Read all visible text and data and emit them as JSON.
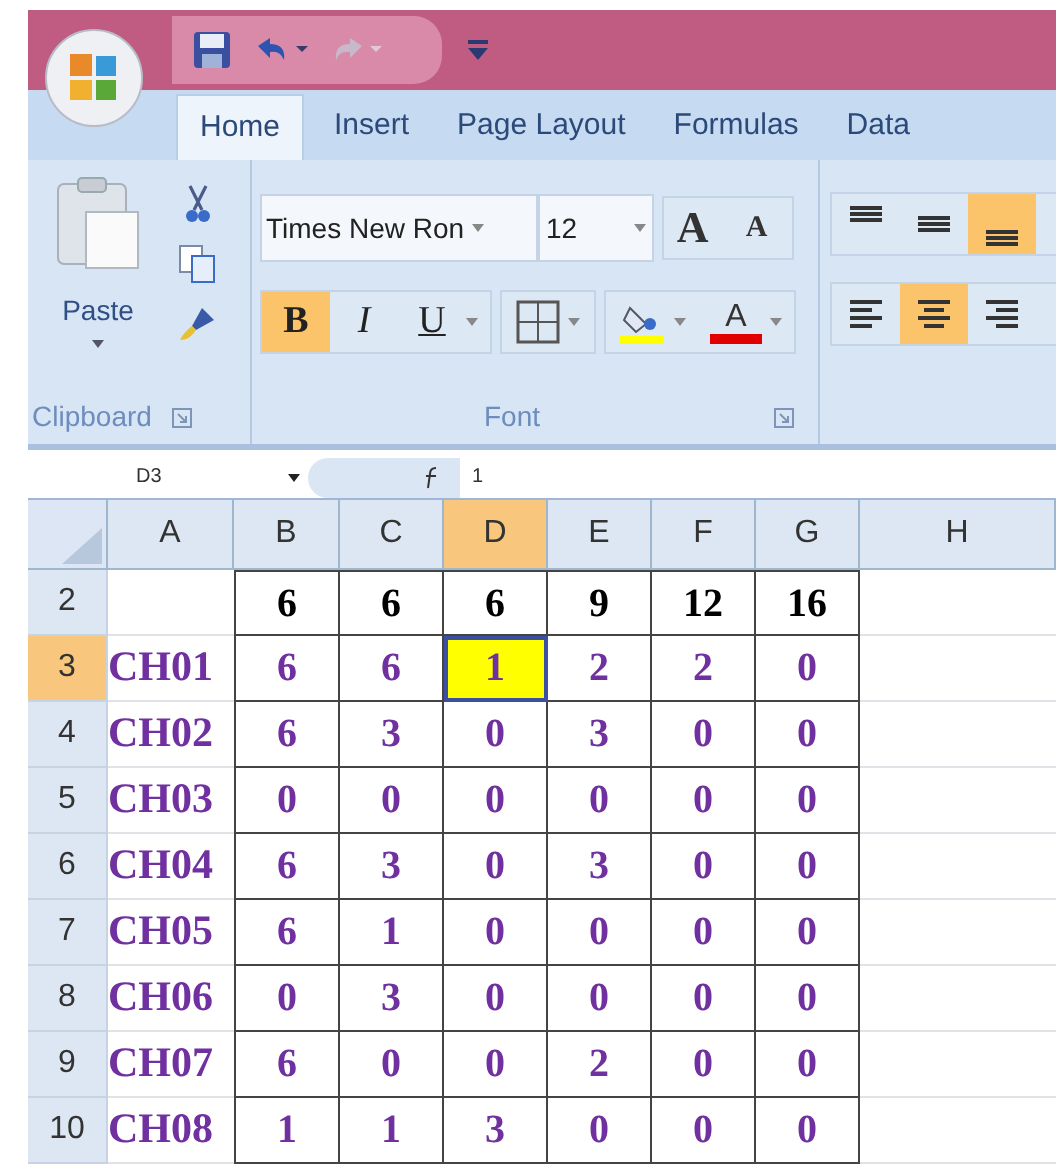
{
  "tabs": [
    {
      "label": "Home",
      "selected": true
    },
    {
      "label": "Insert",
      "selected": false
    },
    {
      "label": "Page Layout",
      "selected": false
    },
    {
      "label": "Formulas",
      "selected": false
    },
    {
      "label": "Data",
      "selected": false
    }
  ],
  "clipboard": {
    "paste_label": "Paste",
    "group_label": "Clipboard"
  },
  "font": {
    "name": "Times New Ron",
    "size": "12",
    "grow_label": "A",
    "shrink_label": "A",
    "font_color_label": "A",
    "group_label": "Font",
    "styles": [
      {
        "kind": "bold",
        "label": "B",
        "selected": true
      },
      {
        "kind": "italic",
        "label": "I",
        "selected": false
      },
      {
        "kind": "underline",
        "label": "U",
        "selected": false
      }
    ]
  },
  "alignment": {
    "vertical": [
      {
        "kind": "top",
        "selected": false
      },
      {
        "kind": "middle",
        "selected": false
      },
      {
        "kind": "bottom",
        "selected": true
      }
    ],
    "horizontal": [
      {
        "kind": "left",
        "selected": false
      },
      {
        "kind": "center",
        "selected": true
      },
      {
        "kind": "right",
        "selected": false
      }
    ]
  },
  "formula_bar": {
    "name_box": "D3",
    "content": "1"
  },
  "columns": [
    {
      "label": "A",
      "selected": false
    },
    {
      "label": "B",
      "selected": false
    },
    {
      "label": "C",
      "selected": false
    },
    {
      "label": "D",
      "selected": true
    },
    {
      "label": "E",
      "selected": false
    },
    {
      "label": "F",
      "selected": false
    },
    {
      "label": "G",
      "selected": false
    },
    {
      "label": "H",
      "selected": false
    }
  ],
  "rows": [
    {
      "label": "2",
      "selected": false,
      "kind": "totals",
      "cells": [
        {
          "selected": false
        },
        {
          "text": "6",
          "selected": false
        },
        {
          "text": "6",
          "selected": false
        },
        {
          "text": "6",
          "selected": false
        },
        {
          "text": "9",
          "selected": false
        },
        {
          "text": "12",
          "selected": false
        },
        {
          "text": "16",
          "selected": false
        }
      ]
    },
    {
      "label": "3",
      "selected": true,
      "kind": "channel",
      "cells": [
        {
          "text": "CH01",
          "selected": false
        },
        {
          "text": "6",
          "selected": false
        },
        {
          "text": "6",
          "selected": false
        },
        {
          "text": "1",
          "selected": true
        },
        {
          "text": "2",
          "selected": false
        },
        {
          "text": "2",
          "selected": false
        },
        {
          "text": "0",
          "selected": false
        }
      ]
    },
    {
      "label": "4",
      "selected": false,
      "kind": "channel",
      "cells": [
        {
          "text": "CH02",
          "selected": false
        },
        {
          "text": "6",
          "selected": false
        },
        {
          "text": "3",
          "selected": false
        },
        {
          "text": "0",
          "selected": false
        },
        {
          "text": "3",
          "selected": false
        },
        {
          "text": "0",
          "selected": false
        },
        {
          "text": "0",
          "selected": false
        }
      ]
    },
    {
      "label": "5",
      "selected": false,
      "kind": "channel",
      "cells": [
        {
          "text": "CH03",
          "selected": false
        },
        {
          "text": "0",
          "selected": false
        },
        {
          "text": "0",
          "selected": false
        },
        {
          "text": "0",
          "selected": false
        },
        {
          "text": "0",
          "selected": false
        },
        {
          "text": "0",
          "selected": false
        },
        {
          "text": "0",
          "selected": false
        }
      ]
    },
    {
      "label": "6",
      "selected": false,
      "kind": "channel",
      "cells": [
        {
          "text": "CH04",
          "selected": false
        },
        {
          "text": "6",
          "selected": false
        },
        {
          "text": "3",
          "selected": false
        },
        {
          "text": "0",
          "selected": false
        },
        {
          "text": "3",
          "selected": false
        },
        {
          "text": "0",
          "selected": false
        },
        {
          "text": "0",
          "selected": false
        }
      ]
    },
    {
      "label": "7",
      "selected": false,
      "kind": "channel",
      "cells": [
        {
          "text": "CH05",
          "selected": false
        },
        {
          "text": "6",
          "selected": false
        },
        {
          "text": "1",
          "selected": false
        },
        {
          "text": "0",
          "selected": false
        },
        {
          "text": "0",
          "selected": false
        },
        {
          "text": "0",
          "selected": false
        },
        {
          "text": "0",
          "selected": false
        }
      ]
    },
    {
      "label": "8",
      "selected": false,
      "kind": "channel",
      "cells": [
        {
          "text": "CH06",
          "selected": false
        },
        {
          "text": "0",
          "selected": false
        },
        {
          "text": "3",
          "selected": false
        },
        {
          "text": "0",
          "selected": false
        },
        {
          "text": "0",
          "selected": false
        },
        {
          "text": "0",
          "selected": false
        },
        {
          "text": "0",
          "selected": false
        }
      ]
    },
    {
      "label": "9",
      "selected": false,
      "kind": "channel",
      "cells": [
        {
          "text": "CH07",
          "selected": false
        },
        {
          "text": "6",
          "selected": false
        },
        {
          "text": "0",
          "selected": false
        },
        {
          "text": "0",
          "selected": false
        },
        {
          "text": "2",
          "selected": false
        },
        {
          "text": "0",
          "selected": false
        },
        {
          "text": "0",
          "selected": false
        }
      ]
    },
    {
      "label": "10",
      "selected": false,
      "kind": "channel",
      "cells": [
        {
          "text": "CH08",
          "selected": false
        },
        {
          "text": "1",
          "selected": false
        },
        {
          "text": "1",
          "selected": false
        },
        {
          "text": "3",
          "selected": false
        },
        {
          "text": "0",
          "selected": false
        },
        {
          "text": "0",
          "selected": false
        },
        {
          "text": "0",
          "selected": false
        }
      ]
    }
  ]
}
